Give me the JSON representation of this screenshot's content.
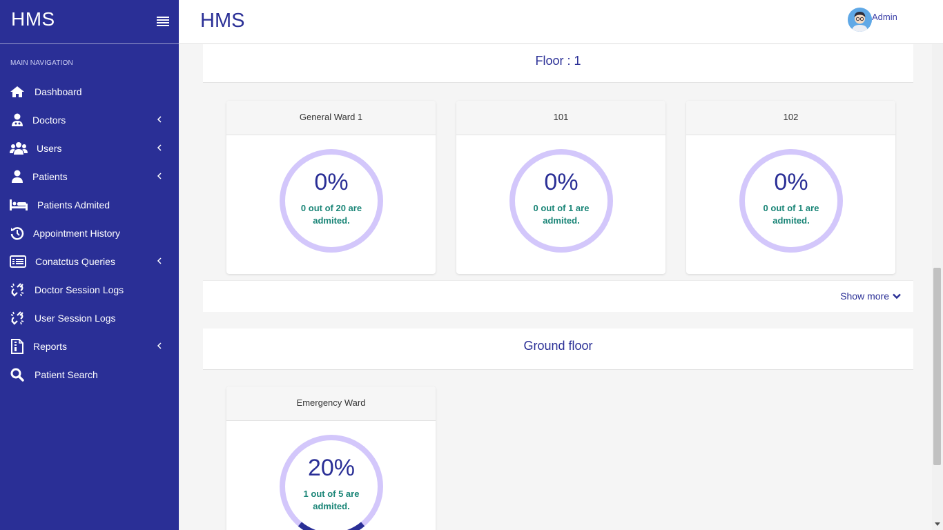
{
  "app": {
    "brand": "HMS",
    "page_title": "HMS",
    "user_label": "Admin"
  },
  "sidebar": {
    "header": "MAIN NAVIGATION",
    "items": [
      {
        "label": "Dashboard",
        "icon": "home-icon",
        "has_submenu": false
      },
      {
        "label": "Doctors",
        "icon": "doctor-icon",
        "has_submenu": true
      },
      {
        "label": "Users",
        "icon": "users-icon",
        "has_submenu": true
      },
      {
        "label": "Patients",
        "icon": "user-icon",
        "has_submenu": true
      },
      {
        "label": "Patients Admited",
        "icon": "bed-icon",
        "has_submenu": false
      },
      {
        "label": "Appointment History",
        "icon": "history-icon",
        "has_submenu": false
      },
      {
        "label": "Conatctus Queries",
        "icon": "list-icon",
        "has_submenu": true
      },
      {
        "label": "Doctor Session Logs",
        "icon": "unlink-icon",
        "has_submenu": false
      },
      {
        "label": "User Session Logs",
        "icon": "unlink-icon",
        "has_submenu": false
      },
      {
        "label": "Reports",
        "icon": "report-icon",
        "has_submenu": true
      },
      {
        "label": "Patient Search",
        "icon": "search-icon",
        "has_submenu": false
      }
    ]
  },
  "floors": [
    {
      "title": "Floor : 1",
      "show_more": "Show more",
      "wards": [
        {
          "name": "General Ward 1",
          "percent": "0%",
          "occupancy": 0,
          "note": "0 out of 20 are admited."
        },
        {
          "name": "101",
          "percent": "0%",
          "occupancy": 0,
          "note": "0 out of 1 are admited."
        },
        {
          "name": "102",
          "percent": "0%",
          "occupancy": 0,
          "note": "0 out of 1 are admited."
        }
      ]
    },
    {
      "title": "Ground floor",
      "wards": [
        {
          "name": "Emergency Ward",
          "percent": "20%",
          "occupancy": 0.2,
          "note": "1 out of 5 are admited."
        }
      ]
    }
  ],
  "colors": {
    "primary": "#2a2f96",
    "ring_track": "#d3c7fb",
    "ring_fill": "#2a2f96",
    "note_text": "#1a8577"
  }
}
